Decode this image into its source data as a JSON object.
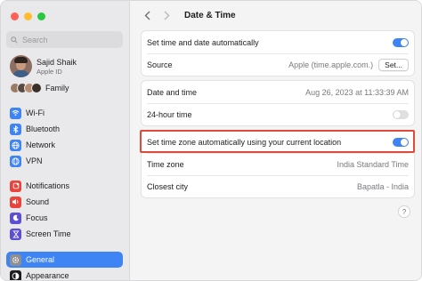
{
  "sidebar": {
    "search_placeholder": "Search",
    "profile": {
      "name": "Sajid Shaik",
      "sub": "Apple ID"
    },
    "family_label": "Family",
    "group1": [
      {
        "label": "Wi-Fi",
        "icon": "wifi-icon",
        "color": "#3f84f5"
      },
      {
        "label": "Bluetooth",
        "icon": "bluetooth-icon",
        "color": "#3f84f5"
      },
      {
        "label": "Network",
        "icon": "network-icon",
        "color": "#3f84f5"
      },
      {
        "label": "VPN",
        "icon": "vpn-icon",
        "color": "#3f84f5"
      }
    ],
    "group2": [
      {
        "label": "Notifications",
        "icon": "notifications-icon",
        "color": "#e9443b"
      },
      {
        "label": "Sound",
        "icon": "sound-icon",
        "color": "#e9443b"
      },
      {
        "label": "Focus",
        "icon": "focus-icon",
        "color": "#5b4fd3"
      },
      {
        "label": "Screen Time",
        "icon": "screen-time-icon",
        "color": "#5b4fd3"
      }
    ],
    "group3": [
      {
        "label": "General",
        "icon": "general-icon",
        "color": "#8e8e93",
        "selected": true
      },
      {
        "label": "Appearance",
        "icon": "appearance-icon",
        "color": "#1d1d1f",
        "selected": false
      }
    ]
  },
  "main": {
    "title": "Date & Time",
    "set_auto_label": "Set time and date automatically",
    "set_auto_on": true,
    "source_label": "Source",
    "source_value": "Apple (time.apple.com.)",
    "set_button": "Set...",
    "date_time_label": "Date and time",
    "date_time_value": "Aug 26, 2023 at 11:33:39 AM",
    "hour24_label": "24-hour time",
    "hour24_on": false,
    "tz_auto_label": "Set time zone automatically using your current location",
    "tz_auto_on": true,
    "timezone_label": "Time zone",
    "timezone_value": "India Standard Time",
    "city_label": "Closest city",
    "city_value": "Bapatla - India",
    "help": "?"
  },
  "colors": {
    "accent": "#3f84f5",
    "highlight": "#e04a3c"
  }
}
